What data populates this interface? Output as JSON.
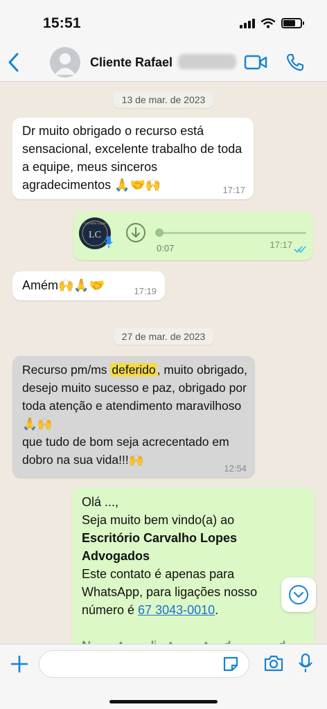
{
  "status_bar": {
    "time": "15:51",
    "battery_level": 0.72,
    "icons": [
      "signal-icon",
      "wifi-icon",
      "battery-icon"
    ]
  },
  "header": {
    "back_icon": "chevron-left-icon",
    "contact_name": "Cliente Rafael",
    "avatar_icon": "person-icon",
    "video_icon": "video-camera-icon",
    "phone_icon": "phone-icon",
    "accent_color": "#1782d6"
  },
  "chat": {
    "date_1": "13 de mar. de 2023",
    "date_2": "27 de mar. de 2023",
    "messages": [
      {
        "direction": "incoming",
        "text": "Dr muito obrigado o recurso está sensacional, excelente trabalho de toda a equipe, meus sinceros agradecimentos 🙏🤝🙌",
        "time": "17:17"
      },
      {
        "direction": "outgoing",
        "type": "voice",
        "avatar_text": "Carvalho Lopes",
        "avatar_monogram": "LC",
        "duration": "0:07",
        "time": "17:17",
        "status": "read"
      },
      {
        "direction": "incoming",
        "text": "Amém🙌🙏🤝",
        "time": "17:19"
      },
      {
        "direction": "incoming",
        "highlighted": true,
        "text_before": "Recurso pm/ms ",
        "text_highlight": "deferido",
        "text_after": ", muito obrigado, desejo muito sucesso e paz, obrigado por toda atenção e atendimento maravilhoso🙏🙌\nque tudo de bom seja acrecentado em dobro na sua vida!!!🙌",
        "time": "12:54"
      },
      {
        "direction": "outgoing",
        "greeting": "Olá ...,",
        "welcome": "Seja muito bem vindo(a) ao",
        "firm_name": "Escritório Carvalho Lopes Advogados",
        "info": "Este contato é apenas para WhatsApp, para ligações nosso número é ",
        "phone": "67 3043-0010",
        "after_phone": ".",
        "partial": "N… …t… …li…t…  …t… d… …  …d… …"
      }
    ]
  },
  "scroll_button_icon": "chevron-down-circle-icon",
  "composer": {
    "plus_icon": "plus-icon",
    "placeholder": "",
    "sticker_icon": "sticker-icon",
    "camera_icon": "camera-icon",
    "mic_icon": "microphone-icon"
  },
  "colors": {
    "chat_background": "#efe9df",
    "outgoing_bubble": "#dbf8c6",
    "incoming_bubble": "#ffffff",
    "highlight": "#f2da4a",
    "read_ticks": "#34b7f1"
  }
}
